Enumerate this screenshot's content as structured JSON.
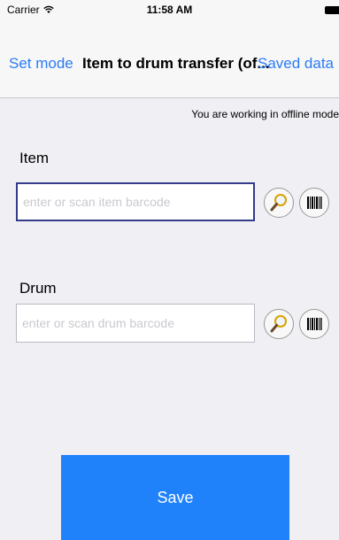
{
  "status_bar": {
    "carrier": "Carrier",
    "time": "11:58 AM"
  },
  "nav": {
    "left_label": "Set mode",
    "title": "Item to drum transfer (of...",
    "right_label": "Saved data"
  },
  "notice": "You are working in offline mode",
  "item": {
    "label": "Item",
    "placeholder": "enter or scan item barcode",
    "value": ""
  },
  "drum": {
    "label": "Drum",
    "placeholder": "enter or scan drum barcode",
    "value": ""
  },
  "save_label": "Save",
  "icons": {
    "search": "magnifier-icon",
    "scan": "barcode-icon",
    "wifi": "wifi-icon",
    "battery": "battery-icon"
  },
  "colors": {
    "accent": "#2a7cf6",
    "save_button": "#1f82fb",
    "active_border": "#353c8a"
  }
}
